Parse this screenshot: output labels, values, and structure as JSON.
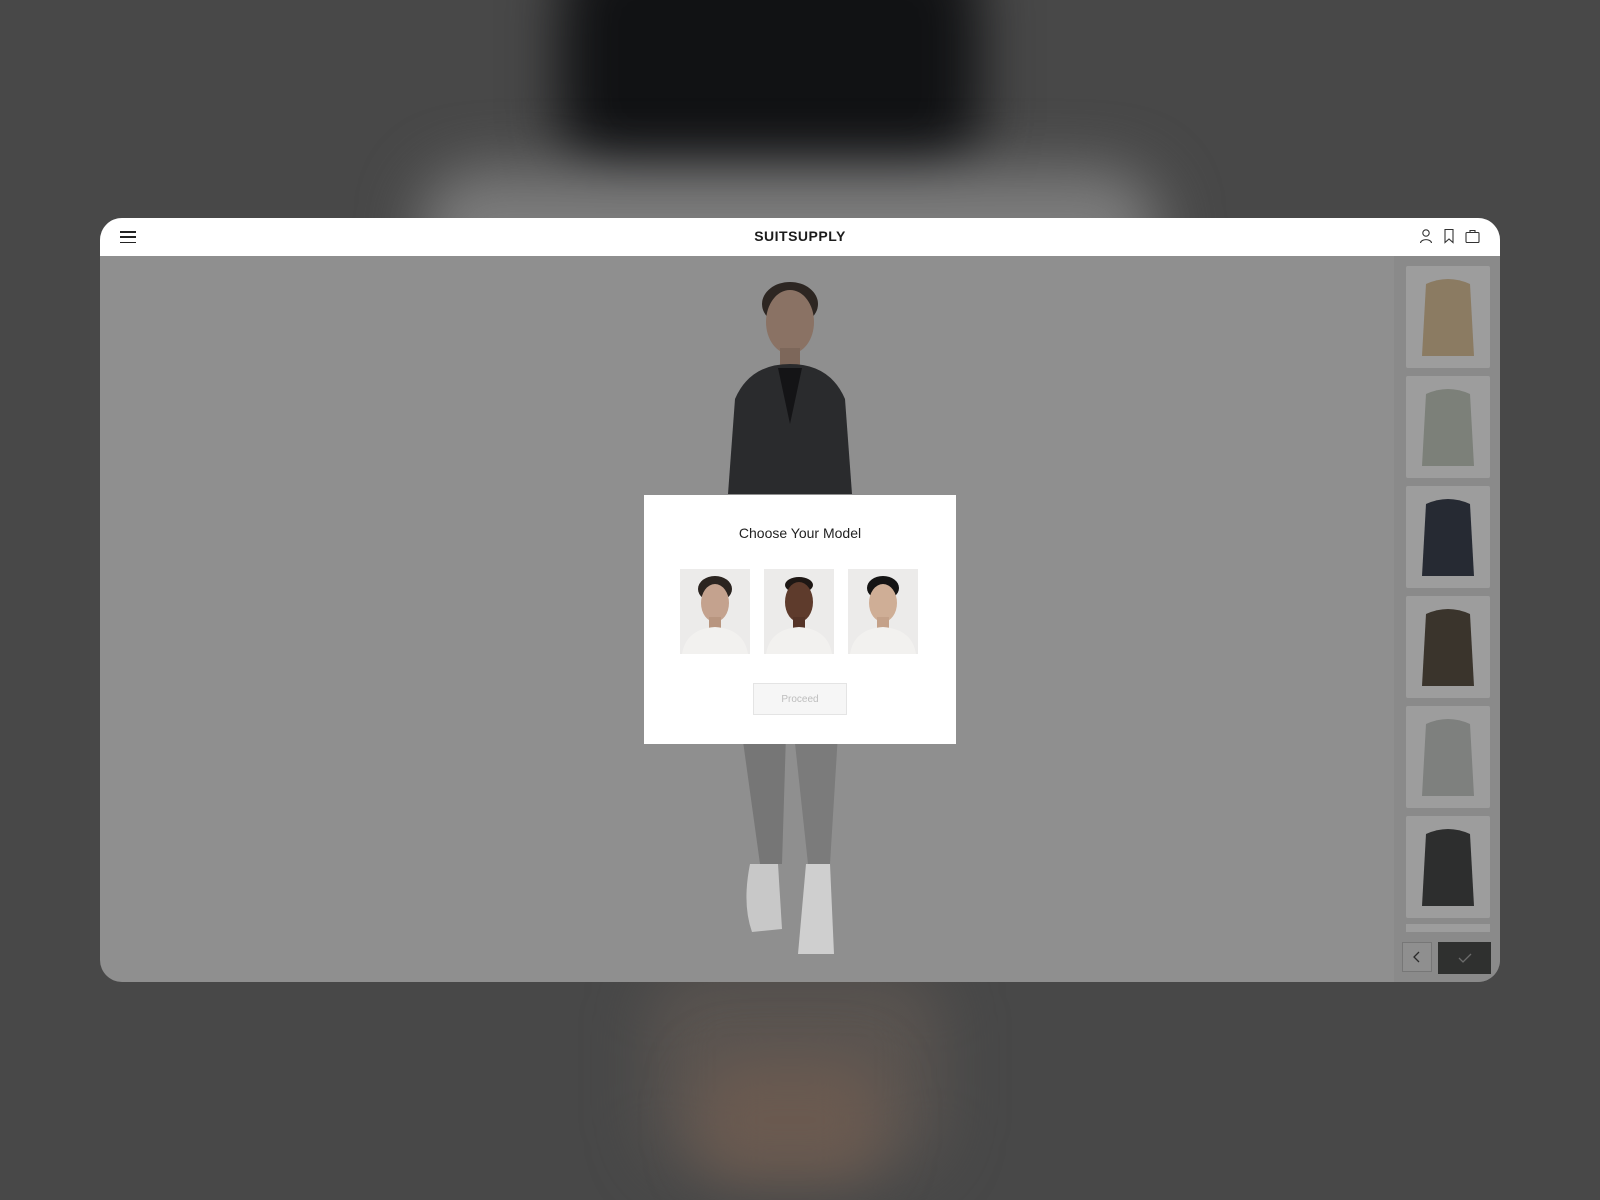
{
  "header": {
    "brand": "SUITSUPPLY",
    "menu_icon": "menu-icon",
    "icons": [
      "account-icon",
      "bookmark-icon",
      "bag-icon"
    ]
  },
  "modal": {
    "title": "Choose Your Model",
    "models": [
      {
        "label": "model-1"
      },
      {
        "label": "model-2"
      },
      {
        "label": "model-3"
      }
    ],
    "proceed_label": "Proceed"
  },
  "rail": {
    "jackets": [
      {
        "color": "#8b7b62"
      },
      {
        "color": "#7c8079"
      },
      {
        "color": "#262a33"
      },
      {
        "color": "#3a342c"
      },
      {
        "color": "#7e807e"
      },
      {
        "color": "#2d2e2e"
      }
    ],
    "prev_icon": "chevron-left-icon",
    "confirm_icon": "check-icon"
  },
  "colors": {
    "overlay": "#8f8f8f",
    "confirm_button": "#2f302f"
  }
}
